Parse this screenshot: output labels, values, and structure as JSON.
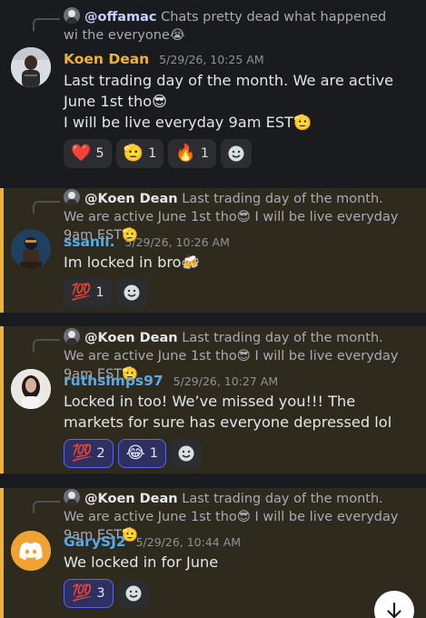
{
  "messages": [
    {
      "reply": {
        "name": "@offamac",
        "text": "Chats pretty dead what happened wi the everyone",
        "emoji": "😭"
      },
      "author": "Koen Dean",
      "author_color": "#f0b232",
      "timestamp": "5/29/26, 10:25 AM",
      "lines": [
        "Last trading day of the month. We are active June 1st tho😎",
        "I will be live everyday 9am EST🫡"
      ],
      "reactions": [
        {
          "emoji": "❤️",
          "count": "5",
          "me": false
        },
        {
          "emoji": "🫡",
          "count": "1",
          "me": false
        },
        {
          "emoji": "🔥",
          "count": "1",
          "me": false
        }
      ]
    },
    {
      "reply": {
        "name": "@Koen Dean",
        "text": "Last trading day of the month. We are active June 1st tho😎  I will be live everyday 9am EST🫡"
      },
      "author": "ssanii.",
      "author_color": "#5aa9e6",
      "timestamp": "5/29/26, 10:26 AM",
      "lines": [
        "Im locked in bro🍻"
      ],
      "reactions": [
        {
          "emoji": "💯",
          "count": "1",
          "me": false
        }
      ]
    },
    {
      "reply": {
        "name": "@Koen Dean",
        "text": "Last trading day of the month. We are active June 1st tho😎  I will be live everyday 9am EST🫡"
      },
      "author": "ruthsimps97",
      "author_color": "#5aa9e6",
      "timestamp": "5/29/26, 10:27 AM",
      "lines": [
        "Locked in too! We’ve missed you!!! The markets for sure has everyone depressed lol"
      ],
      "reactions": [
        {
          "emoji": "💯",
          "count": "2",
          "me": true
        },
        {
          "emoji": "😂",
          "count": "1",
          "me": true
        }
      ]
    },
    {
      "reply": {
        "name": "@Koen Dean",
        "text": "Last trading day of the month. We are active June 1st tho😎  I will be live everyday 9am EST🫡"
      },
      "author": "GarySJ2",
      "author_color": "#5aa9e6",
      "timestamp": "5/29/26, 10:44 AM",
      "lines": [
        "We locked in for June"
      ],
      "reactions": [
        {
          "emoji": "💯",
          "count": "3",
          "me": true
        }
      ]
    }
  ],
  "icons": {
    "add_reaction": "smiley-add-icon",
    "scroll": "arrow-down-icon",
    "discord": "discord-logo-icon"
  }
}
